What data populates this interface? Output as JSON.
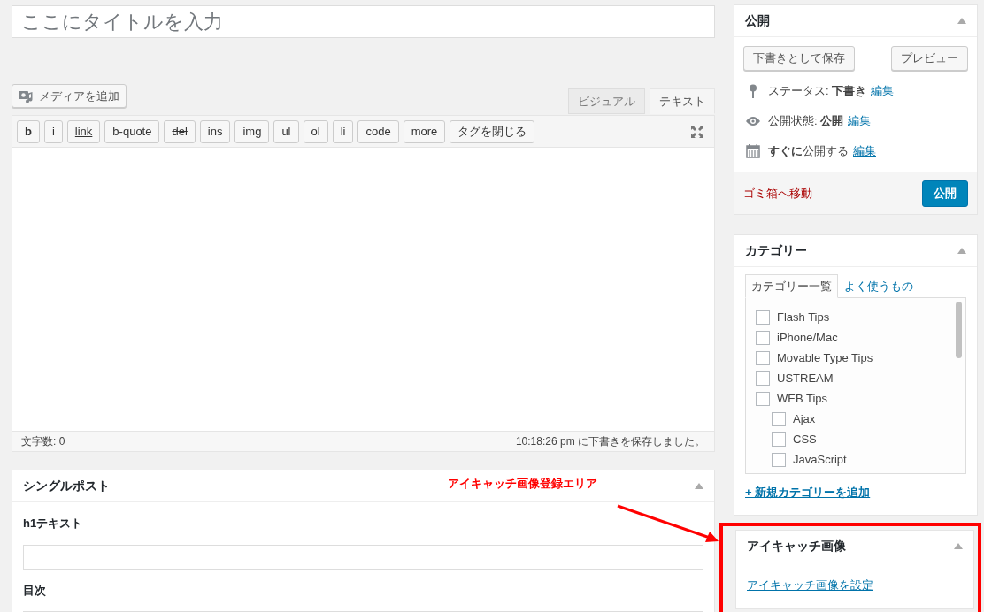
{
  "title_field": {
    "placeholder": "ここにタイトルを入力"
  },
  "add_media_button": "メディアを追加",
  "editor_tabs": [
    {
      "label": "ビジュアル",
      "selected": false
    },
    {
      "label": "テキスト",
      "selected": true
    }
  ],
  "quicktags": [
    {
      "label": "b",
      "kind": "bold"
    },
    {
      "label": "i",
      "kind": "plain"
    },
    {
      "label": "link",
      "kind": "underline"
    },
    {
      "label": "b-quote",
      "kind": "plain"
    },
    {
      "label": "del",
      "kind": "strike"
    },
    {
      "label": "ins",
      "kind": "plain"
    },
    {
      "label": "img",
      "kind": "plain"
    },
    {
      "label": "ul",
      "kind": "plain"
    },
    {
      "label": "ol",
      "kind": "plain"
    },
    {
      "label": "li",
      "kind": "plain"
    },
    {
      "label": "code",
      "kind": "plain"
    },
    {
      "label": "more",
      "kind": "plain"
    },
    {
      "label": "タグを閉じる",
      "kind": "plain"
    }
  ],
  "word_count": "文字数: 0",
  "autosave_status": "10:18:26 pm に下書きを保存しました。",
  "custom_box": {
    "title": "シングルポスト",
    "fields": [
      {
        "label": "h1テキスト"
      },
      {
        "label": "目次"
      }
    ]
  },
  "annotation": "アイキャッチ画像登録エリア",
  "publish_box": {
    "title": "公開",
    "save_draft_button": "下書きとして保存",
    "preview_button": "プレビュー",
    "meta": [
      {
        "kind": "pin",
        "text": "ステータス: **下書き**",
        "edit_link": "編集"
      },
      {
        "kind": "eye",
        "text": "公開状態: **公開**",
        "edit_link": "編集"
      },
      {
        "kind": "calendar",
        "text": "**すぐに**公開する",
        "edit_link": "編集"
      }
    ],
    "trash_link": "ゴミ箱へ移動",
    "publish_button": "公開"
  },
  "category_box": {
    "title": "カテゴリー",
    "tabs": [
      {
        "label": "カテゴリー一覧",
        "selected": true
      },
      {
        "label": "よく使うもの",
        "selected": false
      }
    ],
    "categories": [
      {
        "name": "Flash Tips",
        "checked": false
      },
      {
        "name": "iPhone/Mac",
        "checked": false
      },
      {
        "name": "Movable Type Tips",
        "checked": false
      },
      {
        "name": "USTREAM",
        "checked": false
      },
      {
        "name": "WEB Tips",
        "checked": false,
        "children": [
          {
            "name": "Ajax",
            "checked": false
          },
          {
            "name": "CSS",
            "checked": false
          },
          {
            "name": "JavaScript",
            "checked": false
          }
        ]
      }
    ],
    "add_link": "+ 新規カテゴリーを追加"
  },
  "featured_image_box": {
    "title": "アイキャッチ画像",
    "set_link": "アイキャッチ画像を設定",
    "highlighted": true
  }
}
